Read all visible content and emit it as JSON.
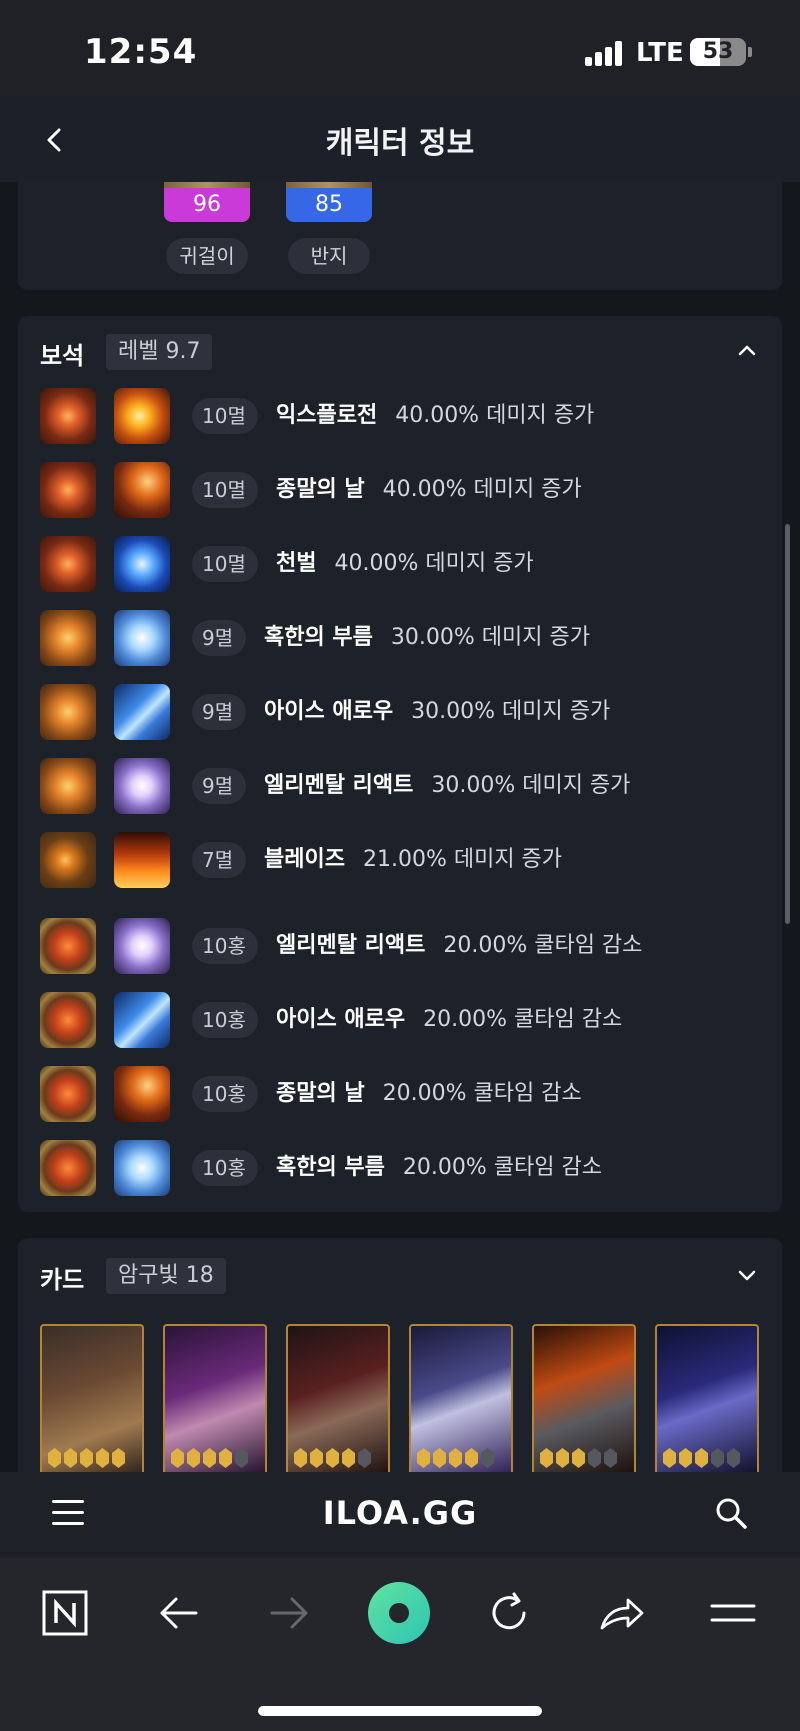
{
  "status": {
    "time": "12:54",
    "network": "LTE",
    "battery_level": 53,
    "battery_text": "53"
  },
  "header": {
    "title": "캐릭터 정보"
  },
  "accessories": [
    {
      "value": "96",
      "label": "귀걸이",
      "color": "#c93ad8"
    },
    {
      "value": "85",
      "label": "반지",
      "color": "#3567e6"
    }
  ],
  "gems": {
    "title": "보석",
    "badge": "레벨 9.7",
    "expanded": true,
    "items": [
      {
        "level": "10멸",
        "skill": "익스플로전",
        "effect": "40.00% 데미지 증가",
        "gem_type": "fire-red",
        "skill_icon": "explosion-icon"
      },
      {
        "level": "10멸",
        "skill": "종말의 날",
        "effect": "40.00% 데미지 증가",
        "gem_type": "fire-red",
        "skill_icon": "doomsday-icon"
      },
      {
        "level": "10멸",
        "skill": "천벌",
        "effect": "40.00% 데미지 증가",
        "gem_type": "fire-red",
        "skill_icon": "punishment-icon"
      },
      {
        "level": "9멸",
        "skill": "혹한의 부름",
        "effect": "30.00% 데미지 증가",
        "gem_type": "fire-amber",
        "skill_icon": "frost-call-icon"
      },
      {
        "level": "9멸",
        "skill": "아이스 애로우",
        "effect": "30.00% 데미지 증가",
        "gem_type": "fire-amber",
        "skill_icon": "ice-arrow-icon"
      },
      {
        "level": "9멸",
        "skill": "엘리멘탈 리액트",
        "effect": "30.00% 데미지 증가",
        "gem_type": "fire-amber",
        "skill_icon": "elemental-react-icon"
      },
      {
        "level": "7멸",
        "skill": "블레이즈",
        "effect": "21.00% 데미지 증가",
        "gem_type": "fire-small",
        "skill_icon": "blaze-icon"
      },
      {
        "level": "10홍",
        "skill": "엘리멘탈 리액트",
        "effect": "20.00% 쿨타임 감소",
        "gem_type": "ruby-orb",
        "skill_icon": "elemental-react-icon"
      },
      {
        "level": "10홍",
        "skill": "아이스 애로우",
        "effect": "20.00% 쿨타임 감소",
        "gem_type": "ruby-orb",
        "skill_icon": "ice-arrow-icon"
      },
      {
        "level": "10홍",
        "skill": "종말의 날",
        "effect": "20.00% 쿨타임 감소",
        "gem_type": "ruby-orb",
        "skill_icon": "doomsday-icon"
      },
      {
        "level": "10홍",
        "skill": "혹한의 부름",
        "effect": "20.00% 쿨타임 감소",
        "gem_type": "ruby-orb",
        "skill_icon": "frost-call-icon"
      }
    ]
  },
  "cards": {
    "title": "카드",
    "badge": "암구빛 18",
    "expanded": false,
    "items": [
      {
        "stars": 5,
        "theme": "brown"
      },
      {
        "stars": 4,
        "theme": "purple"
      },
      {
        "stars": 4,
        "theme": "dark-red"
      },
      {
        "stars": 4,
        "theme": "blue-violet"
      },
      {
        "stars": 3,
        "theme": "orange"
      },
      {
        "stars": 3,
        "theme": "navy"
      }
    ]
  },
  "site": {
    "logo": "ILOA.GG"
  },
  "browser_toolbar": [
    "naver-icon",
    "back-arrow-icon",
    "forward-arrow-icon",
    "green-dot-icon",
    "reload-icon",
    "share-icon",
    "menu-icon"
  ]
}
